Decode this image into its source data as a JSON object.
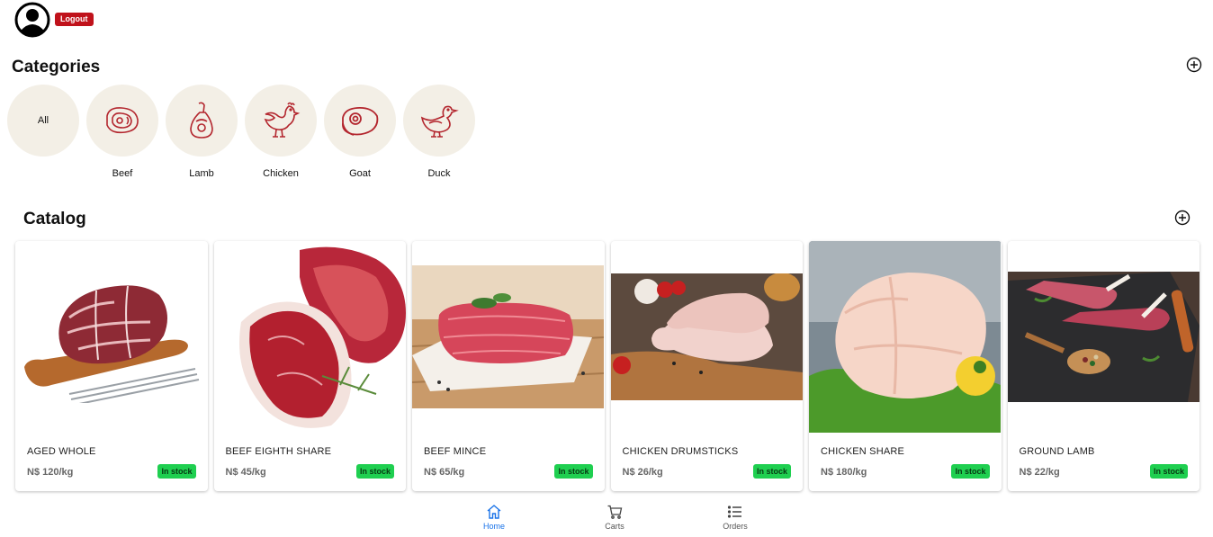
{
  "header": {
    "logout_label": "Logout"
  },
  "categories": {
    "title": "Categories",
    "items": [
      {
        "label": "All",
        "icon": "all"
      },
      {
        "label": "Beef",
        "icon": "beef-icon"
      },
      {
        "label": "Lamb",
        "icon": "lamb-leg-icon"
      },
      {
        "label": "Chicken",
        "icon": "chicken-icon"
      },
      {
        "label": "Goat",
        "icon": "steak-icon"
      },
      {
        "label": "Duck",
        "icon": "duck-icon"
      }
    ]
  },
  "catalog": {
    "title": "Catalog",
    "products": [
      {
        "name": "AGED WHOLE",
        "price": "N$ 120/kg",
        "stock": "In stock"
      },
      {
        "name": "BEEF EIGHTH SHARE",
        "price": "N$ 45/kg",
        "stock": "In stock"
      },
      {
        "name": "BEEF MINCE",
        "price": "N$ 65/kg",
        "stock": "In stock"
      },
      {
        "name": "CHICKEN DRUMSTICKS",
        "price": "N$ 26/kg",
        "stock": "In stock"
      },
      {
        "name": "CHICKEN SHARE",
        "price": "N$ 180/kg",
        "stock": "In stock"
      },
      {
        "name": "GROUND LAMB",
        "price": "N$ 22/kg",
        "stock": "In stock"
      }
    ]
  },
  "nav": {
    "items": [
      {
        "label": "Home",
        "icon": "home-icon",
        "active": true
      },
      {
        "label": "Carts",
        "icon": "cart-icon",
        "active": false
      },
      {
        "label": "Orders",
        "icon": "list-icon",
        "active": false
      }
    ]
  },
  "colors": {
    "accent": "#1a73e8",
    "logout": "#c0121b",
    "stock_badge": "#1fcf50",
    "category_bg": "#f3efe6",
    "icon_red": "#b3262e"
  }
}
